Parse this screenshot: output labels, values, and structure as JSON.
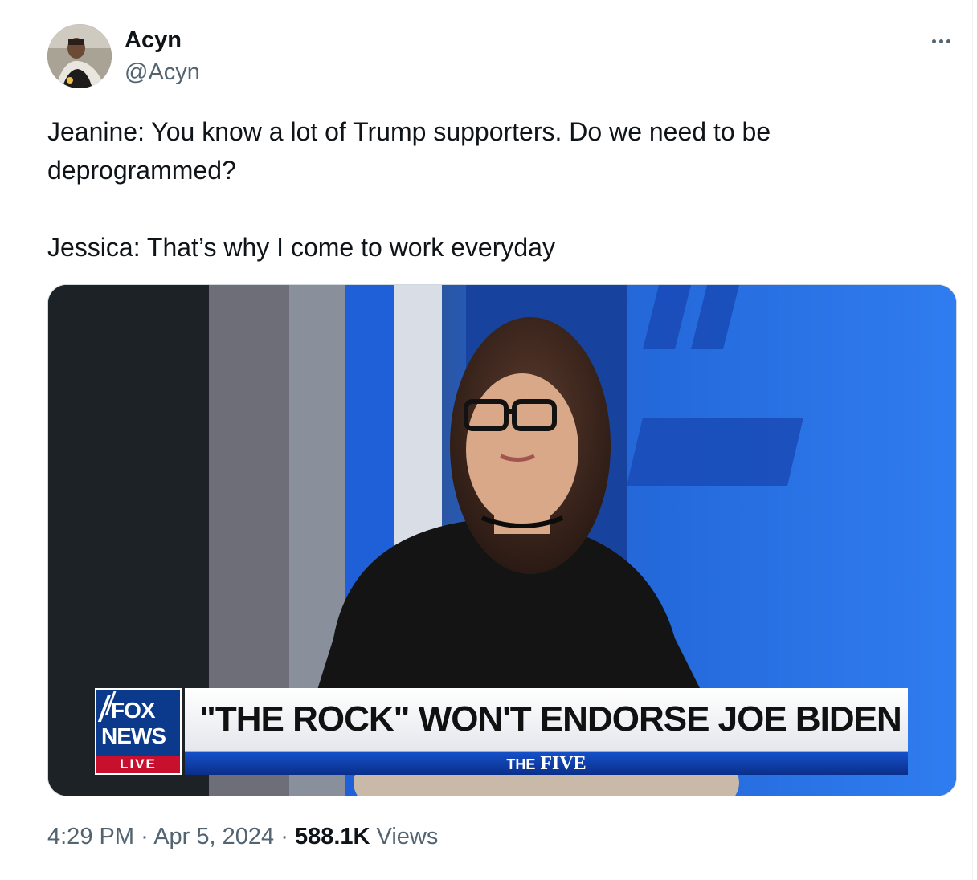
{
  "tweet": {
    "display_name": "Acyn",
    "handle": "@Acyn",
    "more_icon": "ellipsis-icon",
    "text_lines": [
      "Jeanine: You know a lot of Trump supporters. Do we need to be",
      "deprogrammed?",
      "Jessica: That’s why I come to work everyday"
    ],
    "media": {
      "chyron_headline": "\"THE ROCK\" WON'T ENDORSE JOE BIDEN",
      "network_logo_line1": "FOX",
      "network_logo_line2": "NEWS",
      "live_label": "LIVE",
      "show_prefix": "THE",
      "show_name": "FIVE"
    },
    "time": "4:29 PM",
    "date": "Apr 5, 2024",
    "separator": "·",
    "views_count": "588.1K",
    "views_label": "Views"
  },
  "colors": {
    "text_primary": "#0f1419",
    "text_secondary": "#536471",
    "fox_blue": "#0b3a8c",
    "live_red": "#c8102e"
  }
}
